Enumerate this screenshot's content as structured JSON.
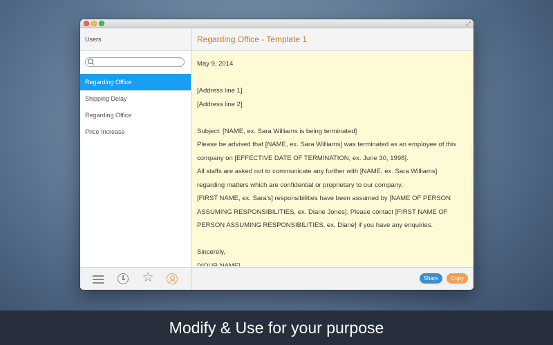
{
  "window": {
    "icons": [
      "close",
      "minimize",
      "zoom",
      "fullscreen"
    ]
  },
  "sidebar": {
    "title": "Users",
    "search": {
      "placeholder": ""
    },
    "items": [
      {
        "label": "Regarding Office",
        "selected": true
      },
      {
        "label": "Shipping Delay"
      },
      {
        "label": "Regarding Office"
      },
      {
        "label": "Price Increase"
      }
    ],
    "footer_icons": [
      "menu-icon",
      "clock-icon",
      "star-icon",
      "user-icon"
    ],
    "selected_color": "#1a9ef2"
  },
  "main": {
    "title": "Regarding Office - Template 1",
    "lines": [
      "May 9, 2014",
      "",
      "[Address line 1]",
      "[Address line 2]",
      "",
      "Subject:    [NAME, ex. Sara Williams is being terminated]",
      "Please be advised that [NAME, ex. Sara Williams] was terminated as an employee of this",
      "company on [EFFECTIVE DATE OF TERMINATION, ex. June 30, 1998].",
      "All staffs are asked not to communicate any further with [NAME, ex. Sara Williams]",
      "regarding matters which are confidential or proprietary to our company.",
      " [FIRST NAME, ex. Sara's] responsibilities have been assumed by [NAME OF PERSON",
      "ASSUMING RESPONSIBILITIES, ex. Diane Jones]. Please contact [FIRST NAME OF",
      "PERSON ASSUMING RESPONSIBILITIES, ex. Diane] if you have any enquiries.",
      "",
      "Sincerely,",
      "[YOUR NAME]"
    ],
    "share_label": "Share",
    "copy_label": "Copy",
    "share_color": "#3b8ed0",
    "copy_color": "#f0a050",
    "title_color": "#c87a2a",
    "doc_background": "#fffad6"
  },
  "caption": "Modify & Use for your purpose"
}
